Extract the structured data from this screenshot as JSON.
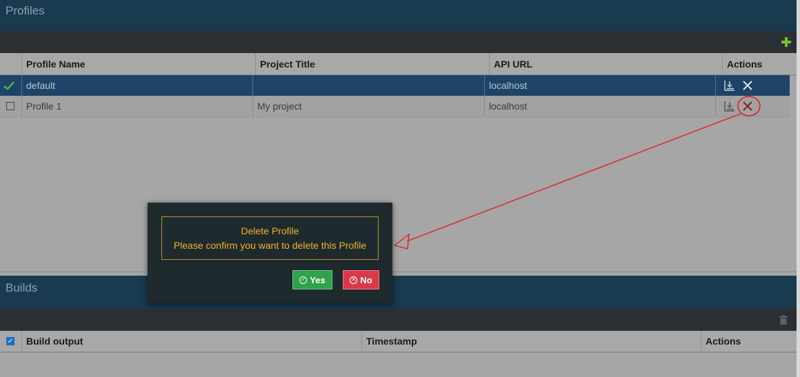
{
  "profiles": {
    "title": "Profiles",
    "add_icon": "plus-icon",
    "columns": [
      "Profile Name",
      "Project Title",
      "API URL",
      "Actions"
    ],
    "rows": [
      {
        "name": "default",
        "project": "",
        "api": "localhost",
        "active": true
      },
      {
        "name": "Profile 1",
        "project": "My project",
        "api": "localhost",
        "active": false
      }
    ]
  },
  "builds": {
    "title": "Builds",
    "delete_icon": "trash-icon",
    "columns": [
      "Build output",
      "Timestamp",
      "Actions"
    ]
  },
  "dialog": {
    "title": "Delete Profile",
    "message": "Please confirm you want to delete this Profile",
    "yes_label": "Yes",
    "no_label": "No"
  },
  "colors": {
    "header_bg": "#1a3a50",
    "toolbar_bg": "#2a3034",
    "selected_row_bg": "#1d4468",
    "dialog_text": "#f0b429",
    "yes_button": "#2fa24a",
    "no_button": "#d9394a",
    "annotation": "#e02020"
  }
}
